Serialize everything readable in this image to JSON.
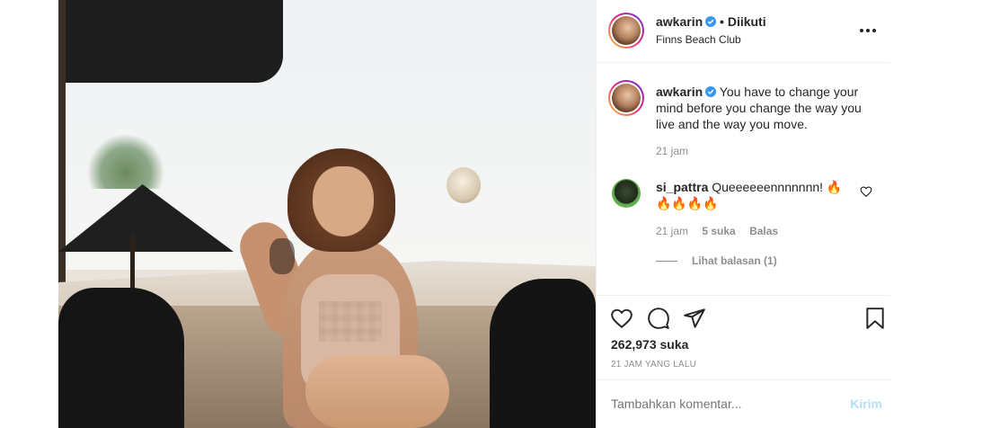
{
  "post": {
    "username": "awkarin",
    "follow_status": "Diikuti",
    "location": "Finns Beach Club"
  },
  "caption": {
    "username": "awkarin",
    "text": "You have to change your mind before you change the way you live and the way you move.",
    "time": "21 jam"
  },
  "comment": {
    "username": "si_pattra",
    "text": "Queeeeeennnnnnn! 🔥🔥🔥🔥🔥",
    "time": "21 jam",
    "likes": "5 suka",
    "reply": "Balas",
    "view_replies": "Lihat balasan (1)"
  },
  "actions": {
    "like_count": "262,973 suka",
    "posted_ago": "21 JAM YANG LALU"
  },
  "add_comment": {
    "placeholder": "Tambahkan komentar...",
    "post_label": "Kirim"
  },
  "colors": {
    "verified": "#3897f0",
    "muted": "#8e8e8e",
    "post_disabled": "#b2dffc"
  }
}
